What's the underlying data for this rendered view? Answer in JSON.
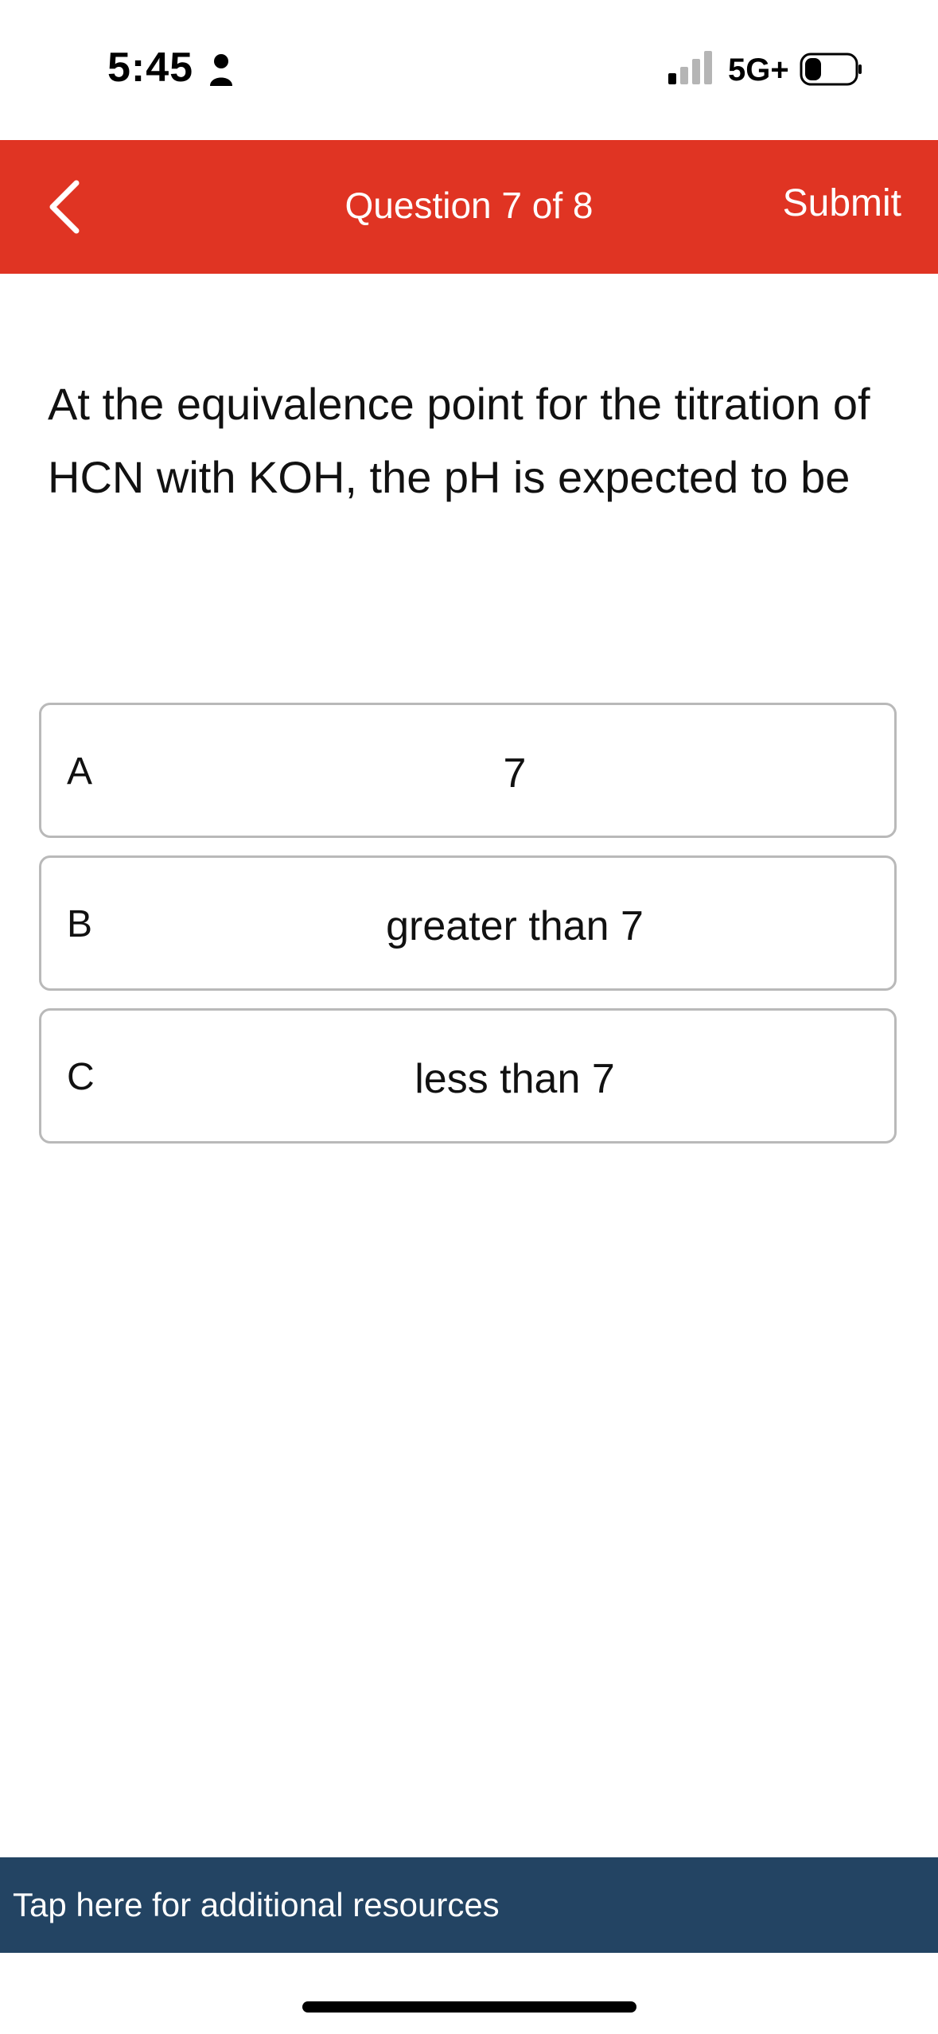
{
  "status_bar": {
    "time": "5:45",
    "network": "5G+"
  },
  "header": {
    "title": "Question 7 of 8",
    "submit_label": "Submit",
    "color": "#e03423"
  },
  "question": {
    "text": "At the equivalence point for the titration of HCN with KOH, the pH is expected to be"
  },
  "options": [
    {
      "letter": "A",
      "text": "7"
    },
    {
      "letter": "B",
      "text": "greater than 7"
    },
    {
      "letter": "C",
      "text": "less than 7"
    }
  ],
  "resources": {
    "label": "Tap here for additional resources",
    "color": "#234463"
  },
  "icons": {
    "back": "chevron-left-icon",
    "person": "person-icon",
    "signal": "cellular-signal-icon",
    "battery": "battery-icon"
  }
}
